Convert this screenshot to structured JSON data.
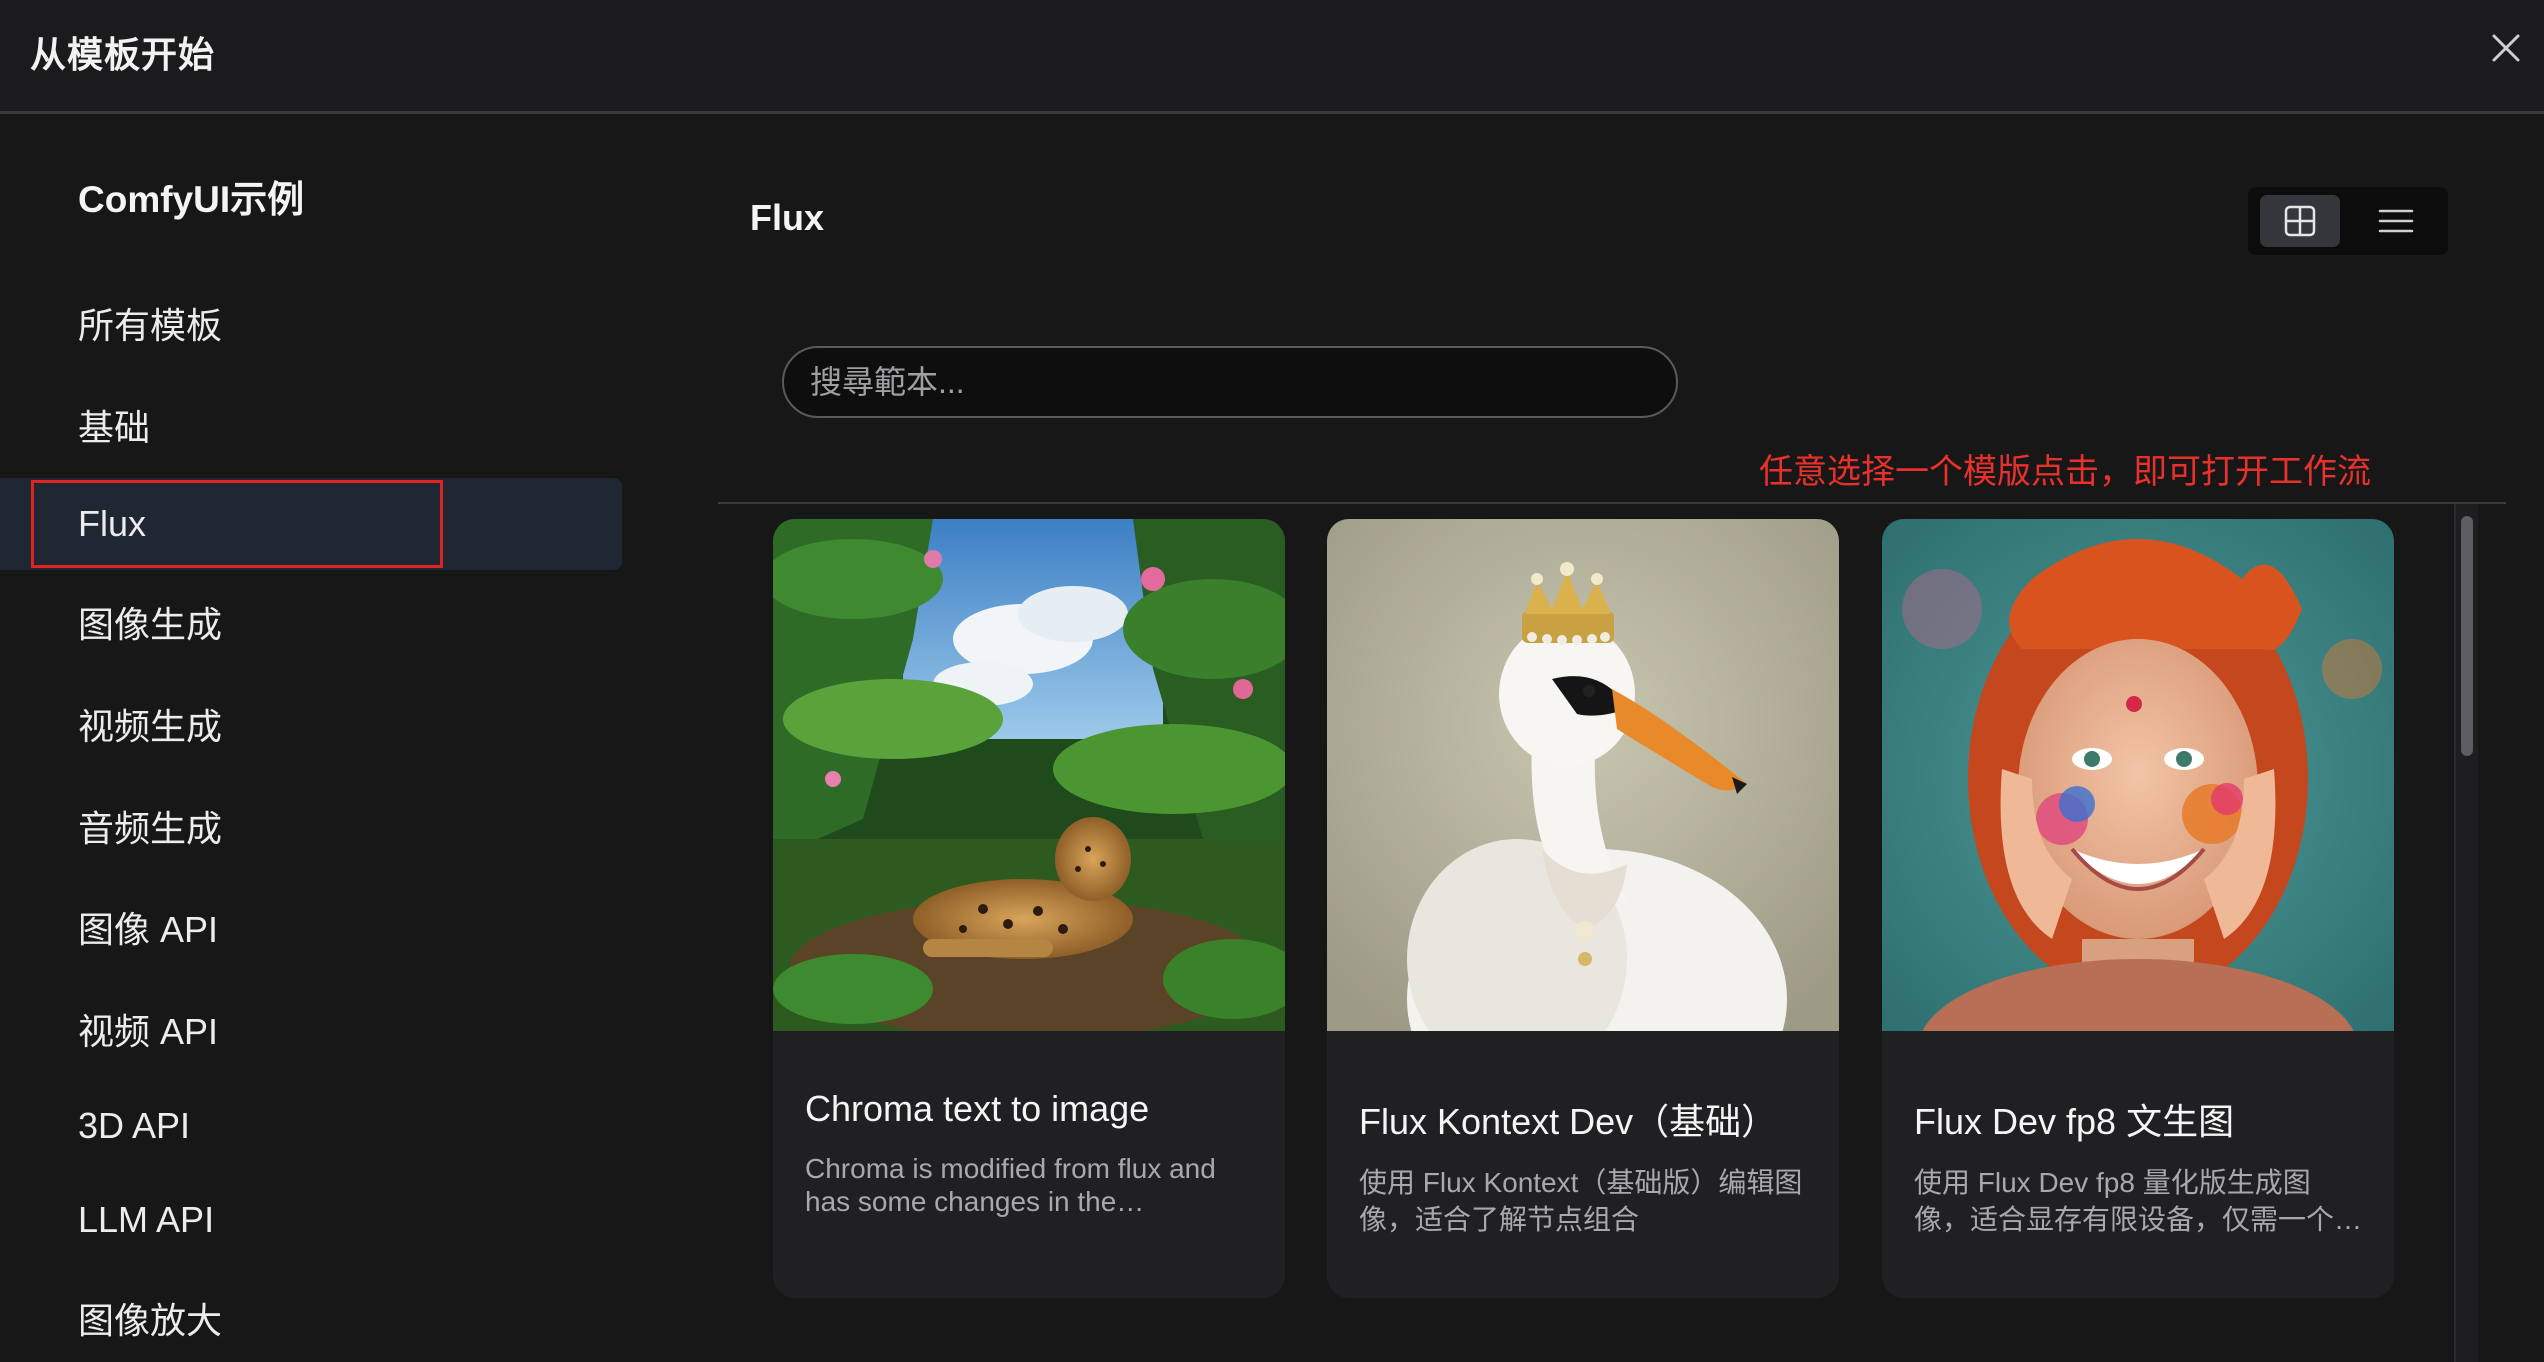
{
  "header": {
    "title": "从模板开始"
  },
  "sidebar": {
    "heading": "ComfyUI示例",
    "items": [
      {
        "label": "所有模板"
      },
      {
        "label": "基础"
      },
      {
        "label": "Flux"
      },
      {
        "label": "图像生成"
      },
      {
        "label": "视频生成"
      },
      {
        "label": "音频生成"
      },
      {
        "label": "图像 API"
      },
      {
        "label": "视频 API"
      },
      {
        "label": "3D API"
      },
      {
        "label": "LLM API"
      },
      {
        "label": "图像放大"
      }
    ],
    "active_item": "Flux"
  },
  "main": {
    "title": "Flux",
    "view_modes": {
      "active": "grid",
      "icons": [
        "grid-view-icon",
        "list-view-icon"
      ]
    },
    "search": {
      "placeholder": "搜尋範本...",
      "value": ""
    },
    "annotation": "任意选择一个模版点击，即可打开工作流",
    "cards": [
      {
        "title": "Chroma text to image",
        "description": "Chroma is modified from flux and has some changes in the…",
        "thumbnail": "jaguar-in-jungle"
      },
      {
        "title": "Flux Kontext Dev（基础）",
        "description": "使用 Flux Kontext（基础版）编辑图像，适合了解节点组合",
        "thumbnail": "swan-with-crown"
      },
      {
        "title": "Flux Dev fp8 文生图",
        "description": "使用 Flux Dev fp8 量化版生成图像，适合显存有限设备，仅需一个…",
        "thumbnail": "smiling-woman-with-paint"
      }
    ]
  },
  "colors": {
    "background": "#171718",
    "active_item": "#1f2733",
    "annotation": "#e8312b",
    "highlight_border": "#e02424"
  }
}
